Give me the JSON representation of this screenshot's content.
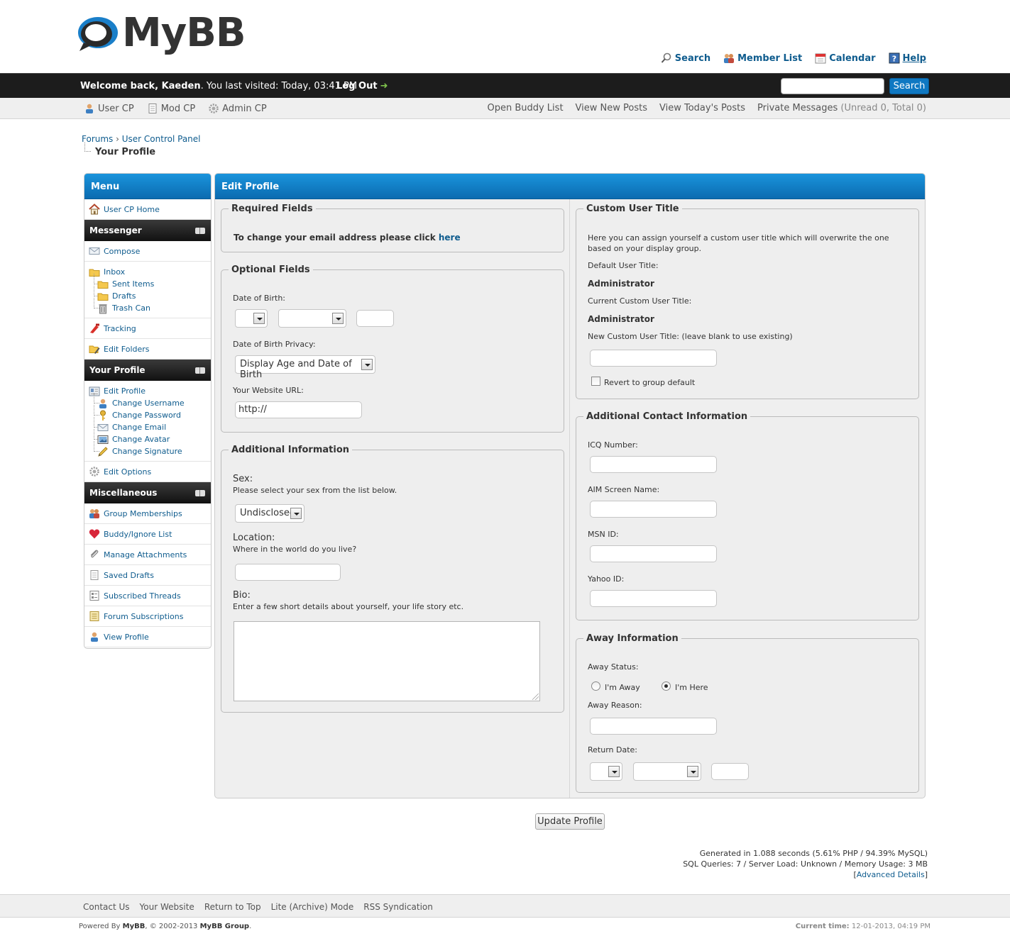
{
  "header": {
    "logo_text": "MyBB",
    "top_links": [
      {
        "label": "Search",
        "icon": "magnifier-icon"
      },
      {
        "label": "Member List",
        "icon": "members-icon"
      },
      {
        "label": "Calendar",
        "icon": "calendar-icon"
      },
      {
        "label": "Help",
        "icon": "help-icon"
      }
    ]
  },
  "panel": {
    "welcome_prefix": "Welcome back, ",
    "username": "Kaeden",
    "last_visit_text": ". You last visited: Today, 03:41 PM",
    "logout_label": "Log Out",
    "search_placeholder": "",
    "search_button": "Search"
  },
  "subbar": {
    "user_cp": "User CP",
    "mod_cp": "Mod CP",
    "admin_cp": "Admin CP",
    "open_buddy_list": "Open Buddy List",
    "view_new_posts": "View New Posts",
    "view_todays_posts": "View Today's Posts",
    "private_messages": "Private Messages",
    "pm_counts": "(Unread 0, Total 0)"
  },
  "breadcrumb": {
    "forums": "Forums",
    "sep": "›",
    "user_cp": "User Control Panel",
    "current": "Your Profile"
  },
  "menu": {
    "title": "Menu",
    "user_cp_home": "User CP Home",
    "messenger": {
      "title": "Messenger",
      "compose": "Compose",
      "inbox": "Inbox",
      "sent_items": "Sent Items",
      "drafts": "Drafts",
      "trash_can": "Trash Can",
      "tracking": "Tracking",
      "edit_folders": "Edit Folders"
    },
    "profile": {
      "title": "Your Profile",
      "edit_profile": "Edit Profile",
      "change_username": "Change Username",
      "change_password": "Change Password",
      "change_email": "Change Email",
      "change_avatar": "Change Avatar",
      "change_signature": "Change Signature",
      "edit_options": "Edit Options"
    },
    "misc": {
      "title": "Miscellaneous",
      "group_memberships": "Group Memberships",
      "buddy_ignore": "Buddy/Ignore List",
      "manage_attachments": "Manage Attachments",
      "saved_drafts": "Saved Drafts",
      "subscribed_threads": "Subscribed Threads",
      "forum_subscriptions": "Forum Subscriptions",
      "view_profile": "View Profile"
    }
  },
  "edit_profile": {
    "title": "Edit Profile",
    "required": {
      "legend": "Required Fields",
      "email_text": "To change your email address please click ",
      "email_link": "here"
    },
    "optional": {
      "legend": "Optional Fields",
      "dob_label": "Date of Birth:",
      "dob_day": "",
      "dob_month": "",
      "dob_year": "",
      "dob_privacy_label": "Date of Birth Privacy:",
      "dob_privacy_value": "Display Age and Date of Birth",
      "website_label": "Your Website URL:",
      "website_value": "http://"
    },
    "additional": {
      "legend": "Additional Information",
      "sex_label": "Sex:",
      "sex_desc": "Please select your sex from the list below.",
      "sex_value": "Undisclosed",
      "location_label": "Location:",
      "location_desc": "Where in the world do you live?",
      "location_value": "",
      "bio_label": "Bio:",
      "bio_desc": "Enter a few short details about yourself, your life story etc.",
      "bio_value": ""
    },
    "custom_title": {
      "legend": "Custom User Title",
      "desc": "Here you can assign yourself a custom user title which will overwrite the one based on your display group.",
      "default_label": "Default User Title:",
      "default_value": "Administrator",
      "current_label": "Current Custom User Title:",
      "current_value": "Administrator",
      "new_label": "New Custom User Title: (leave blank to use existing)",
      "new_value": "",
      "revert_label": "Revert to group default"
    },
    "contact": {
      "legend": "Additional Contact Information",
      "icq_label": "ICQ Number:",
      "aim_label": "AIM Screen Name:",
      "msn_label": "MSN ID:",
      "yahoo_label": "Yahoo ID:",
      "icq_value": "",
      "aim_value": "",
      "msn_value": "",
      "yahoo_value": ""
    },
    "away": {
      "legend": "Away Information",
      "status_label": "Away Status:",
      "away_option": "I'm Away",
      "here_option": "I'm Here",
      "selected": "I'm Here",
      "reason_label": "Away Reason:",
      "reason_value": "",
      "return_label": "Return Date:"
    },
    "update_button": "Update Profile"
  },
  "debug": {
    "line1": "Generated in 1.088 seconds (5.61% PHP / 94.39% MySQL)",
    "line2": "SQL Queries: 7 / Server Load: Unknown / Memory Usage: 3 MB",
    "advanced_link": "Advanced Details"
  },
  "footer": {
    "links": [
      "Contact Us",
      "Your Website",
      "Return to Top",
      "Lite (Archive) Mode",
      "RSS Syndication"
    ],
    "powered_by": "Powered By ",
    "mybb": "MyBB",
    "copyright_mid": ", © 2002-2013 ",
    "group": "MyBB Group",
    "copyright_end": ".",
    "current_time_label": "Current time:",
    "current_time_value": "12-01-2013, 04:19 PM"
  },
  "colors": {
    "accent_blue": "#0f78c2",
    "link": "#0f5c8e",
    "dark_bar": "#1c1c1c"
  }
}
